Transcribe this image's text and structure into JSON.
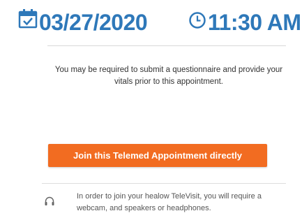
{
  "colors": {
    "accent": "#2e78b9",
    "button_bg": "#f26c21"
  },
  "appointment": {
    "date": "03/27/2020",
    "time": "11:30 AM",
    "date_icon": "calendar-check-icon",
    "time_icon": "clock-icon"
  },
  "notice": {
    "text": "You may be required to submit a questionnaire and provide your vitals prior to this appointment."
  },
  "actions": {
    "join_label": "Join this Telemed Appointment directly"
  },
  "requirements": {
    "icon": "headphones-icon",
    "text": "In order to join your healow TeleVisit, you will require a webcam, and speakers or headphones."
  }
}
